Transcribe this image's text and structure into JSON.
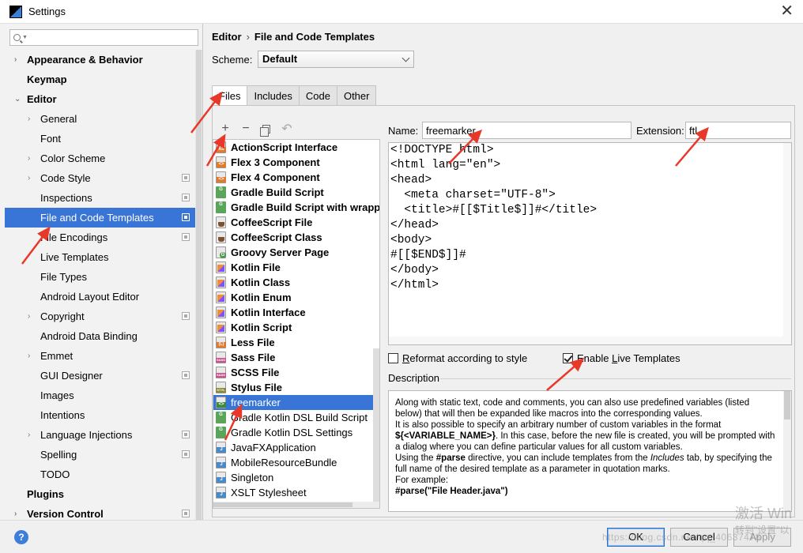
{
  "window": {
    "title": "Settings",
    "close_glyph": "✕"
  },
  "search": {
    "placeholder": "",
    "value": ""
  },
  "sidebar": {
    "items": [
      {
        "label": "Appearance & Behavior",
        "level": 0,
        "bold": true,
        "arrow": "›",
        "project": false
      },
      {
        "label": "Keymap",
        "level": 0,
        "bold": true,
        "arrow": "",
        "project": false
      },
      {
        "label": "Editor",
        "level": 0,
        "bold": true,
        "arrow": "⌄",
        "project": false
      },
      {
        "label": "General",
        "level": 1,
        "bold": false,
        "arrow": "›",
        "project": false
      },
      {
        "label": "Font",
        "level": 1,
        "bold": false,
        "arrow": "",
        "project": false
      },
      {
        "label": "Color Scheme",
        "level": 1,
        "bold": false,
        "arrow": "›",
        "project": false
      },
      {
        "label": "Code Style",
        "level": 1,
        "bold": false,
        "arrow": "›",
        "project": true
      },
      {
        "label": "Inspections",
        "level": 1,
        "bold": false,
        "arrow": "",
        "project": true
      },
      {
        "label": "File and Code Templates",
        "level": 1,
        "bold": false,
        "arrow": "",
        "project": true,
        "selected": true
      },
      {
        "label": "File Encodings",
        "level": 1,
        "bold": false,
        "arrow": "",
        "project": true
      },
      {
        "label": "Live Templates",
        "level": 1,
        "bold": false,
        "arrow": "",
        "project": false
      },
      {
        "label": "File Types",
        "level": 1,
        "bold": false,
        "arrow": "",
        "project": false
      },
      {
        "label": "Android Layout Editor",
        "level": 1,
        "bold": false,
        "arrow": "",
        "project": false
      },
      {
        "label": "Copyright",
        "level": 1,
        "bold": false,
        "arrow": "›",
        "project": true
      },
      {
        "label": "Android Data Binding",
        "level": 1,
        "bold": false,
        "arrow": "",
        "project": false
      },
      {
        "label": "Emmet",
        "level": 1,
        "bold": false,
        "arrow": "›",
        "project": false
      },
      {
        "label": "GUI Designer",
        "level": 1,
        "bold": false,
        "arrow": "",
        "project": true
      },
      {
        "label": "Images",
        "level": 1,
        "bold": false,
        "arrow": "",
        "project": false
      },
      {
        "label": "Intentions",
        "level": 1,
        "bold": false,
        "arrow": "",
        "project": false
      },
      {
        "label": "Language Injections",
        "level": 1,
        "bold": false,
        "arrow": "›",
        "project": true
      },
      {
        "label": "Spelling",
        "level": 1,
        "bold": false,
        "arrow": "",
        "project": true
      },
      {
        "label": "TODO",
        "level": 1,
        "bold": false,
        "arrow": "",
        "project": false
      },
      {
        "label": "Plugins",
        "level": 0,
        "bold": true,
        "arrow": "",
        "project": false
      },
      {
        "label": "Version Control",
        "level": 0,
        "bold": true,
        "arrow": "›",
        "project": true
      }
    ]
  },
  "breadcrumb": {
    "parent": "Editor",
    "separator": "›",
    "current": "File and Code Templates"
  },
  "scheme": {
    "label": "Scheme:",
    "value": "Default"
  },
  "tabs": [
    {
      "label": "Files",
      "active": true
    },
    {
      "label": "Includes",
      "active": false
    },
    {
      "label": "Code",
      "active": false
    },
    {
      "label": "Other",
      "active": false
    }
  ],
  "toolbar": {
    "add": "+",
    "remove": "−",
    "reset": "↶"
  },
  "templates": [
    {
      "label": "ActionScript Interface",
      "icon": "as",
      "bold": true
    },
    {
      "label": "Flex 3 Component",
      "icon": "flex",
      "bold": true
    },
    {
      "label": "Flex 4 Component",
      "icon": "flex",
      "bold": true
    },
    {
      "label": "Gradle Build Script",
      "icon": "gradle",
      "bold": true
    },
    {
      "label": "Gradle Build Script with wrappe",
      "icon": "gradle",
      "bold": true
    },
    {
      "label": "CoffeeScript File",
      "icon": "coffee",
      "bold": true
    },
    {
      "label": "CoffeeScript Class",
      "icon": "coffee",
      "bold": true
    },
    {
      "label": "Groovy Server Page",
      "icon": "groovy",
      "bold": true
    },
    {
      "label": "Kotlin File",
      "icon": "kotlin",
      "bold": true
    },
    {
      "label": "Kotlin Class",
      "icon": "kotlin",
      "bold": true
    },
    {
      "label": "Kotlin Enum",
      "icon": "kotlin",
      "bold": true
    },
    {
      "label": "Kotlin Interface",
      "icon": "kotlin",
      "bold": true
    },
    {
      "label": "Kotlin Script",
      "icon": "kotlin",
      "bold": true
    },
    {
      "label": "Less File",
      "icon": "less",
      "bold": true
    },
    {
      "label": "Sass File",
      "icon": "sass",
      "bold": true
    },
    {
      "label": "SCSS File",
      "icon": "sass",
      "bold": true
    },
    {
      "label": "Stylus File",
      "icon": "styl",
      "bold": true
    },
    {
      "label": "freemarker",
      "icon": "ftl",
      "bold": false,
      "selected": true
    },
    {
      "label": "Gradle Kotlin DSL Build Script",
      "icon": "gradle",
      "bold": false
    },
    {
      "label": "Gradle Kotlin DSL Settings",
      "icon": "gradle",
      "bold": false
    },
    {
      "label": "JavaFXApplication",
      "icon": "java",
      "bold": false
    },
    {
      "label": "MobileResourceBundle",
      "icon": "java",
      "bold": false
    },
    {
      "label": "Singleton",
      "icon": "java",
      "bold": false
    },
    {
      "label": "XSLT Stylesheet",
      "icon": "java",
      "bold": false
    }
  ],
  "name": {
    "label": "Name:",
    "value": "freemarker"
  },
  "extension": {
    "label": "Extension:",
    "value": "ftl"
  },
  "editor": {
    "lines": [
      "<!DOCTYPE html>",
      "<html lang=\"en\">",
      "<head>",
      "  <meta charset=\"UTF-8\">",
      "  <title>#[[$Title$]]#</title>",
      "</head>",
      "<body>",
      "#[[$END$]]#",
      "</body>",
      "</html>"
    ]
  },
  "options": {
    "reformat": {
      "prefix": "",
      "mnemonic": "R",
      "rest": "eformat according to style",
      "checked": false
    },
    "live_templates": {
      "prefix": "Enable ",
      "mnemonic": "L",
      "rest": "ive Templates",
      "checked": true
    }
  },
  "description": {
    "label": "Description",
    "p1": "Along with static text, code and comments, you can also use predefined variables (listed below) that will then be expanded like macros into the corresponding values.",
    "p2a": "It is also possible to specify an arbitrary number of custom variables in the format ",
    "p2b": "${<VARIABLE_NAME>}",
    "p2c": ". In this case, before the new file is created, you will be prompted with a dialog where you can define particular values for all custom variables.",
    "p3a": "Using the ",
    "p3b": "#parse",
    "p3c": " directive, you can include templates from the ",
    "p3d": "Includes",
    "p3e": " tab, by specifying the full name of the desired template as a parameter in quotation marks.",
    "p4": "For example:",
    "p5": "#parse(\"File Header.java\")"
  },
  "buttons": {
    "ok": "OK",
    "cancel": "Cancel",
    "apply": "Apply",
    "help": "?"
  },
  "overlays": {
    "activation_line1": "激活 Win",
    "activation_line2": "转到\"设置\"以",
    "blog": "https://blog.csdn.net/qq_40637478"
  },
  "colors": {
    "selection": "#3875d6",
    "annotation": "#e8382a"
  }
}
